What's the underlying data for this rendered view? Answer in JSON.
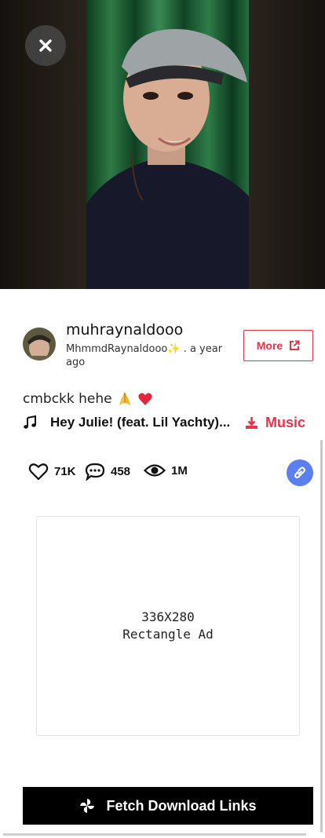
{
  "video": {
    "close_icon": "close-icon"
  },
  "author": {
    "username": "muhraynaldooo",
    "display_name": "MhmmdRaynaldooo✨",
    "time_ago": " . a year ago",
    "more_label": "More",
    "more_icon": "external-link-icon"
  },
  "post": {
    "caption": "cmbckk hehe",
    "caption_emojis": [
      "folded-hands-emoji",
      "red-heart-emoji"
    ],
    "song_title": "Hey Julie! (feat. Lil Yachty)...",
    "music_label": "Music",
    "music_icon": "download-icon"
  },
  "stats": {
    "likes": "71K",
    "comments": "458",
    "views": "1M"
  },
  "ad": {
    "line1": "336X280",
    "line2": "Rectangle Ad"
  },
  "actions": {
    "fetch_label": "Fetch Download Links"
  },
  "colors": {
    "accent": "#e8334a",
    "link_button": "#5b7ef0",
    "fetch_button": "#000000"
  }
}
